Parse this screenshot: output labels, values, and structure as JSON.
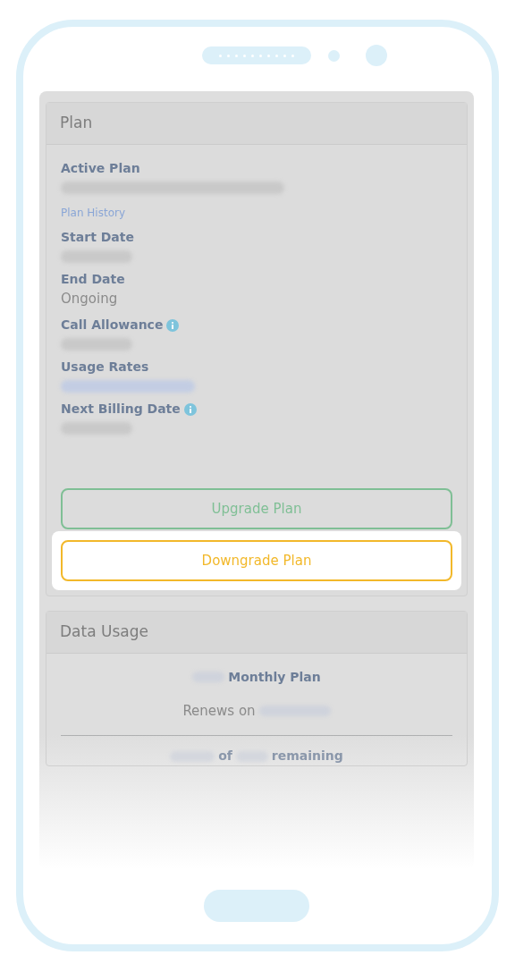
{
  "plan_card": {
    "title": "Plan",
    "fields": [
      {
        "kind": "text",
        "label": "Active Plan",
        "value_blurred": true,
        "info": false
      },
      {
        "kind": "link",
        "text": "Plan History"
      },
      {
        "kind": "text",
        "label": "Start Date",
        "value_blurred": true,
        "info": false
      },
      {
        "kind": "text",
        "label": "End Date",
        "value": "Ongoing",
        "info": false
      },
      {
        "kind": "text",
        "label": "Call Allowance",
        "value_blurred": true,
        "info": true
      },
      {
        "kind": "linkvalue",
        "label": "Usage Rates",
        "value_blurred": true,
        "info": false
      },
      {
        "kind": "text",
        "label": "Next Billing Date",
        "value_blurred": true,
        "info": true
      }
    ],
    "buttons": [
      {
        "label": "Upgrade Plan",
        "kind": "success",
        "highlighted": false
      },
      {
        "label": "Downgrade Plan",
        "kind": "warning",
        "highlighted": true
      }
    ]
  },
  "data_usage_card": {
    "title": "Data Usage",
    "plan_line": "Monthly Plan",
    "renews": "Renews on",
    "remaining_of": "of",
    "remaining": "remaining"
  }
}
